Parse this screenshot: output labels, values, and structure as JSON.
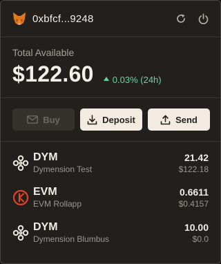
{
  "header": {
    "address": "0xbfcf...9248",
    "logo_icon": "metamask-fox-icon",
    "refresh_icon": "refresh-icon",
    "power_icon": "power-icon"
  },
  "balance": {
    "label": "Total Available",
    "value": "$122.60",
    "change": "0.03% (24h)",
    "change_direction": "up",
    "change_color": "#63d6a4"
  },
  "actions": {
    "buy_label": "Buy",
    "buy_enabled": false,
    "deposit_label": "Deposit",
    "send_label": "Send"
  },
  "tokens": [
    {
      "symbol": "DYM",
      "name": "Dymension Test",
      "amount": "21.42",
      "usd": "$122.18",
      "icon": "dymension-logo-icon"
    },
    {
      "symbol": "EVM",
      "name": "EVM Rollapp",
      "amount": "0.6611",
      "usd": "$0.4157",
      "icon": "evm-rollapp-logo-icon",
      "icon_color": "#e2432a"
    },
    {
      "symbol": "DYM",
      "name": "Dymension Blumbus",
      "amount": "10.00",
      "usd": "$0.0",
      "icon": "dymension-logo-icon"
    }
  ],
  "colors": {
    "background": "#221f1c",
    "accent_button": "#f3ebe1",
    "positive": "#63d6a4"
  }
}
